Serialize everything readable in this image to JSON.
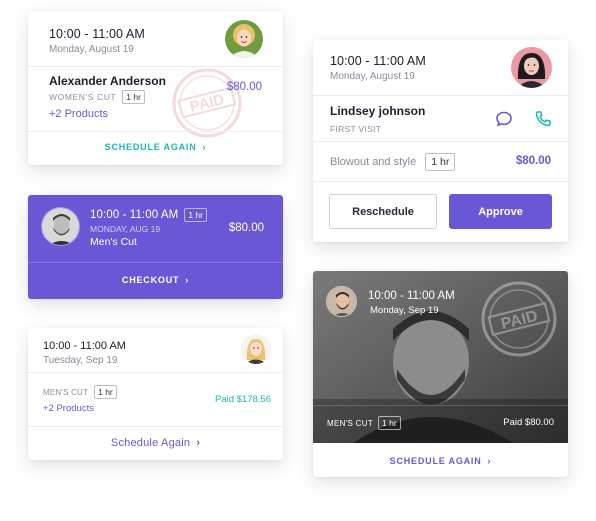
{
  "card1": {
    "time": "10:00 - 11:00 AM",
    "date": "Monday, August 19",
    "client": "Alexander Anderson",
    "service": "WOMEN'S CUT",
    "duration": "1 hr",
    "price": "$80.00",
    "more": "+2 Products",
    "stamp_text": "PAID",
    "action": "SCHEDULE AGAIN"
  },
  "card2": {
    "time": "10:00 - 11:00 AM",
    "date": "Monday, August 19",
    "client": "Lindsey johnson",
    "visit": "FIRST VISIT",
    "service": "Blowout and style",
    "duration": "1 hr",
    "price": "$80.00",
    "reschedule": "Reschedule",
    "approve": "Approve"
  },
  "card3": {
    "time": "10:00 - 11:00 AM",
    "duration": "1 hr",
    "date": "MONDAY, AUG 19",
    "service": "Men's Cut",
    "price": "$80.00",
    "action": "CHECKOUT"
  },
  "card4": {
    "time": "10:00 - 11:00 AM",
    "date": "Tuesday, Sep 19",
    "service": "MEN'S CUT",
    "duration": "1 hr",
    "more": "+2 Products",
    "paid": "Paid $178.56",
    "action": "Schedule Again"
  },
  "card5": {
    "time": "10:00 - 11:00 AM",
    "date": "Monday, Sep 19",
    "service": "MEN'S CUT",
    "duration": "1 hr",
    "paid": "Paid $80.00",
    "stamp_text": "PAID",
    "action": "SCHEDULE AGAIN"
  },
  "colors": {
    "primary": "#6a57d6",
    "teal": "#1fb6ad",
    "stamp": "#e0737d"
  }
}
